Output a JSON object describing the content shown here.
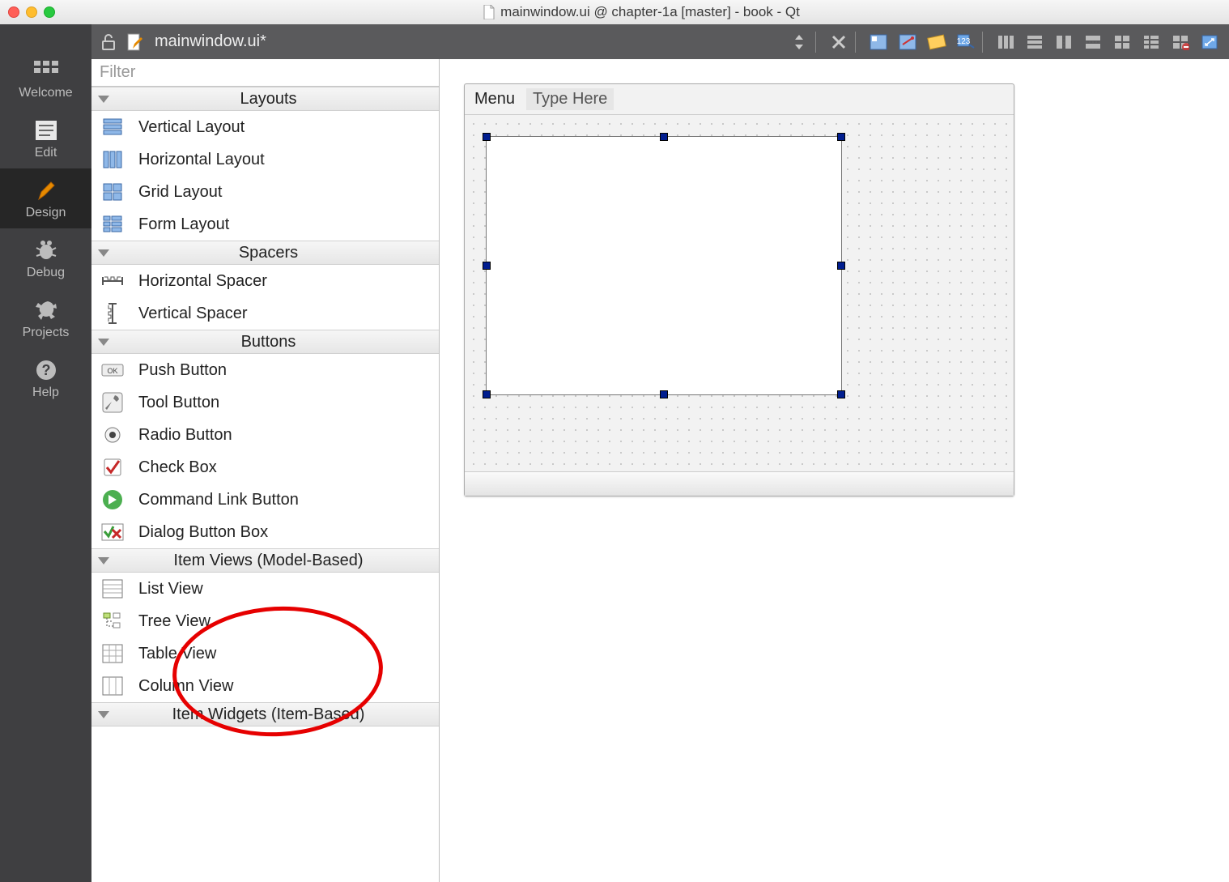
{
  "window_title": "mainwindow.ui @ chapter-1a [master] - book - Qt",
  "editor_file_label": "mainwindow.ui*",
  "modes": [
    {
      "label": "Welcome"
    },
    {
      "label": "Edit"
    },
    {
      "label": "Design"
    },
    {
      "label": "Debug"
    },
    {
      "label": "Projects"
    },
    {
      "label": "Help"
    }
  ],
  "filter_placeholder": "Filter",
  "categories": [
    {
      "name": "Layouts",
      "items": [
        "Vertical Layout",
        "Horizontal Layout",
        "Grid Layout",
        "Form Layout"
      ]
    },
    {
      "name": "Spacers",
      "items": [
        "Horizontal Spacer",
        "Vertical Spacer"
      ]
    },
    {
      "name": "Buttons",
      "items": [
        "Push Button",
        "Tool Button",
        "Radio Button",
        "Check Box",
        "Command Link Button",
        "Dialog Button Box"
      ]
    },
    {
      "name": "Item Views (Model-Based)",
      "items": [
        "List View",
        "Tree View",
        "Table View",
        "Column View"
      ]
    },
    {
      "name": "Item Widgets (Item-Based)",
      "items": []
    }
  ],
  "form": {
    "menu_label": "Menu",
    "type_here": "Type Here"
  }
}
